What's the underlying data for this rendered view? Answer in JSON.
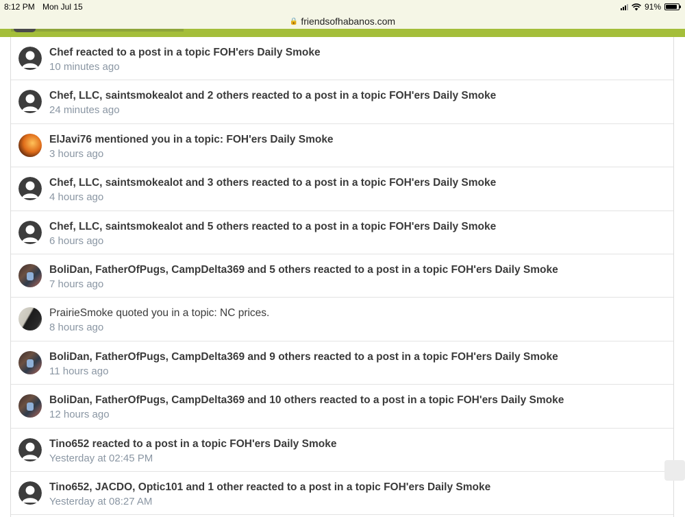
{
  "status": {
    "time": "8:12 PM",
    "date": "Mon Jul 15",
    "battery": "91%"
  },
  "browser": {
    "url": "friendsofhabanos.com"
  },
  "notifications": [
    {
      "text": "Chef reacted to a post in a topic FOH'ers Daily Smoke",
      "time": "10 minutes ago",
      "avatar": "default-avatar",
      "bold": true
    },
    {
      "text": "Chef, LLC, saintsmokealot and 2 others reacted to a post in a topic FOH'ers Daily Smoke",
      "time": "24 minutes ago",
      "avatar": "default-avatar",
      "bold": true
    },
    {
      "text": "ElJavi76 mentioned you in a topic: FOH'ers Daily Smoke",
      "time": "3 hours ago",
      "avatar": "user-photo",
      "bold": true
    },
    {
      "text": "Chef, LLC, saintsmokealot and 3 others reacted to a post in a topic FOH'ers Daily Smoke",
      "time": "4 hours ago",
      "avatar": "default-avatar",
      "bold": true
    },
    {
      "text": "Chef, LLC, saintsmokealot and 5 others reacted to a post in a topic FOH'ers Daily Smoke",
      "time": "6 hours ago",
      "avatar": "default-avatar",
      "bold": true
    },
    {
      "text": "BoliDan, FatherOfPugs, CampDelta369 and 5 others reacted to a post in a topic FOH'ers Daily Smoke",
      "time": "7 hours ago",
      "avatar": "user-photo",
      "bold": true
    },
    {
      "text": "PrairieSmoke quoted you in a topic: NC prices.",
      "time": "8 hours ago",
      "avatar": "user-photo",
      "bold": false
    },
    {
      "text": "BoliDan, FatherOfPugs, CampDelta369 and 9 others reacted to a post in a topic FOH'ers Daily Smoke",
      "time": "11 hours ago",
      "avatar": "user-photo",
      "bold": true
    },
    {
      "text": "BoliDan, FatherOfPugs, CampDelta369 and 10 others reacted to a post in a topic FOH'ers Daily Smoke",
      "time": "12 hours ago",
      "avatar": "user-photo",
      "bold": true
    },
    {
      "text": "Tino652 reacted to a post in a topic FOH'ers Daily Smoke",
      "time": "Yesterday at 02:45 PM",
      "avatar": "default-avatar",
      "bold": true
    },
    {
      "text": "Tino652, JACDO, Optic101 and 1 other reacted to a post in a topic FOH'ers Daily Smoke",
      "time": "Yesterday at 08:27 AM",
      "avatar": "default-avatar",
      "bold": true
    }
  ],
  "colors": {
    "accent": "#a4be3a",
    "time_text": "#8a96a3"
  }
}
